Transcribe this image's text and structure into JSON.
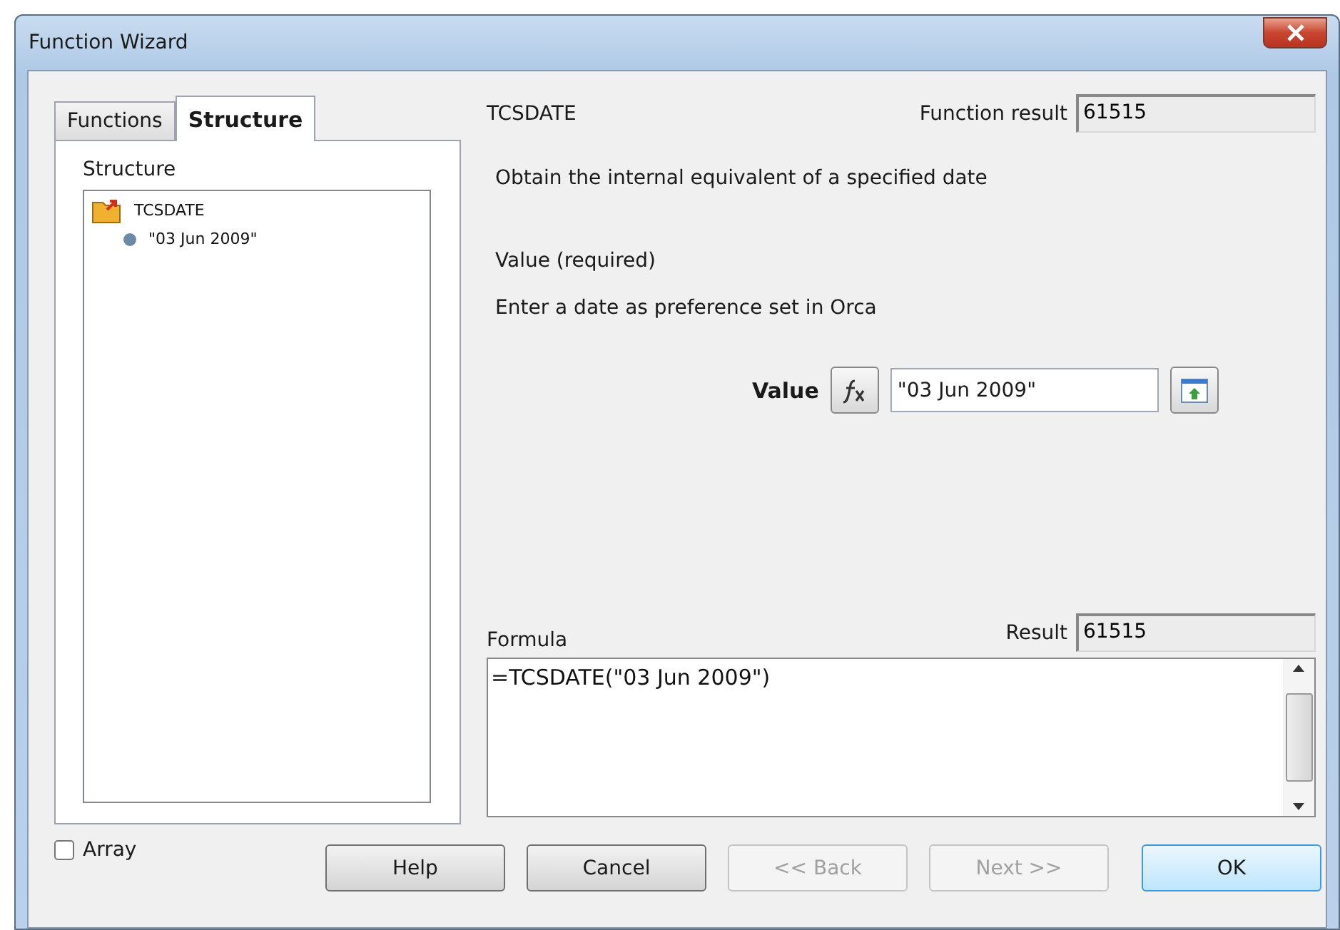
{
  "window": {
    "title": "Function Wizard"
  },
  "tabs": [
    {
      "label": "Functions",
      "selected": false
    },
    {
      "label": "Structure",
      "selected": true
    }
  ],
  "structure": {
    "label": "Structure",
    "tree": [
      {
        "label": "TCSDATE",
        "kind": "function",
        "children": [
          {
            "label": "\"03 Jun 2009\"",
            "kind": "argument"
          }
        ]
      }
    ]
  },
  "function": {
    "name": "TCSDATE",
    "result_label": "Function result",
    "result": "61515",
    "description": "Obtain the internal equivalent of a specified date",
    "argument_title": "Value (required)",
    "argument_hint": "Enter a date as preference set in Orca"
  },
  "argument": {
    "label": "Value",
    "value": "\"03 Jun 2009\""
  },
  "formula": {
    "label": "Formula",
    "result_label": "Result",
    "result": "61515",
    "value": "=TCSDATE(\"03 Jun 2009\")"
  },
  "array": {
    "label": "Array",
    "checked": false
  },
  "buttons": [
    {
      "label": "Help",
      "disabled": false,
      "default": false
    },
    {
      "label": "Cancel",
      "disabled": false,
      "default": false
    },
    {
      "label": "<< Back",
      "disabled": true,
      "default": false
    },
    {
      "label": "Next >>",
      "disabled": true,
      "default": false
    },
    {
      "label": "OK",
      "disabled": false,
      "default": true
    }
  ]
}
